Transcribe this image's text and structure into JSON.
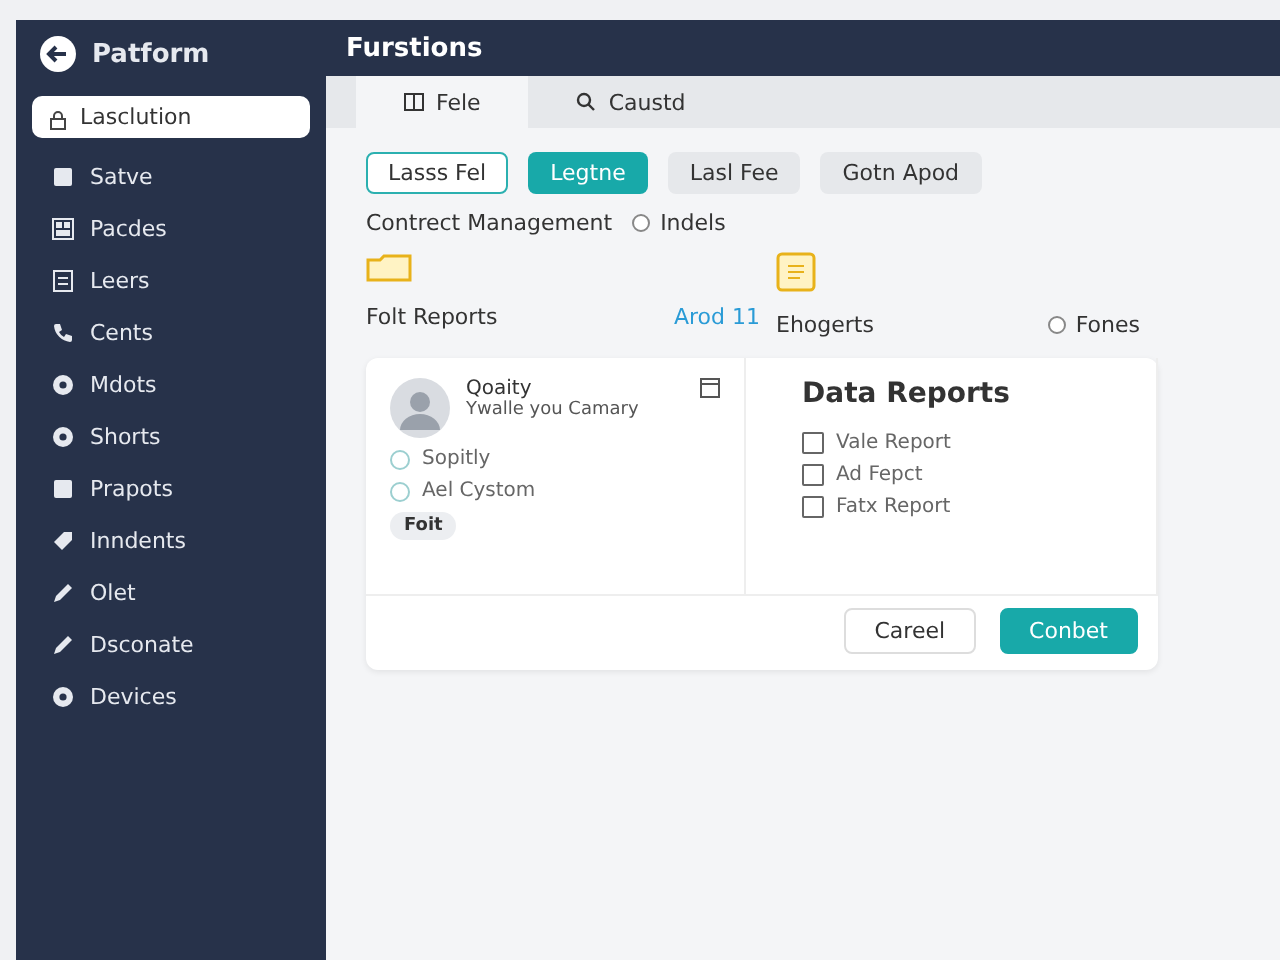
{
  "sidebar": {
    "title": "Patform",
    "search": {
      "value": "Lasclution"
    },
    "items": [
      {
        "label": "Satve",
        "kind": "square"
      },
      {
        "label": "Pacdes",
        "kind": "grid"
      },
      {
        "label": "Leers",
        "kind": "doc"
      },
      {
        "label": "Cents",
        "kind": "phone"
      },
      {
        "label": "Mdots",
        "kind": "circle"
      },
      {
        "label": "Shorts",
        "kind": "circle"
      },
      {
        "label": "Prapots",
        "kind": "square"
      },
      {
        "label": "Inndents",
        "kind": "tag"
      },
      {
        "label": "Olet",
        "kind": "pen"
      },
      {
        "label": "Dsconate",
        "kind": "pen"
      },
      {
        "label": "Devices",
        "kind": "circle"
      }
    ]
  },
  "header": {
    "title": "Furstions"
  },
  "tabs": [
    {
      "label": "Fele",
      "kind": "book",
      "selected": true
    },
    {
      "label": "Caustd",
      "kind": "search",
      "selected": false
    }
  ],
  "chips": [
    {
      "label": "Lasss Fel",
      "kind": "outline"
    },
    {
      "label": "Legtne",
      "kind": "filled"
    },
    {
      "label": "Lasl Fee",
      "kind": "plain"
    },
    {
      "label": "Gotn Apod",
      "kind": "plain"
    }
  ],
  "section": {
    "title": "Contrect Management",
    "radio": {
      "label": "Indels",
      "selected": false
    }
  },
  "groups": [
    {
      "title": "Folt Reports",
      "link": "Arod 11",
      "kind": "folder"
    },
    {
      "title": "Ehogerts",
      "radio": {
        "label": "Fones",
        "selected": false
      },
      "kind": "note"
    }
  ],
  "profile_card": {
    "name": "Qoaity",
    "subtitle": "Ywalle you Camary",
    "items": [
      "Sopitly",
      "Ael Cystom"
    ],
    "tag": "Foit"
  },
  "reports_card": {
    "title": "Data Reports",
    "items": [
      {
        "label": "Vale Report",
        "checked": false
      },
      {
        "label": "Ad Fepct",
        "checked": false
      },
      {
        "label": "Fatx Report",
        "checked": false
      }
    ]
  },
  "buttons": [
    {
      "label": "Careel",
      "kind": "secondary"
    },
    {
      "label": "Conbet",
      "kind": "primary"
    }
  ]
}
